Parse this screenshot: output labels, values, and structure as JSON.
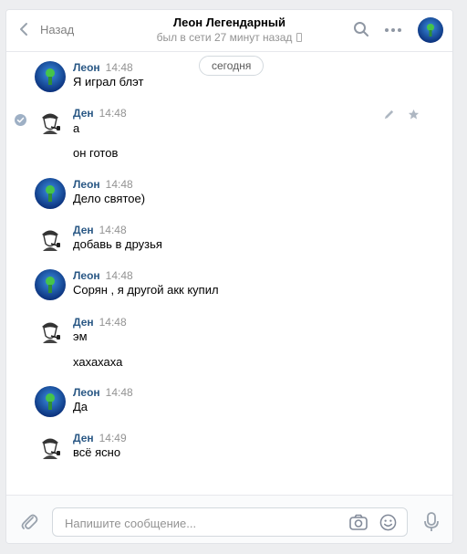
{
  "header": {
    "back_label": "Назад",
    "title": "Леон Легендарный",
    "subtitle": "был в сети 27 минут назад"
  },
  "date_label": "сегодня",
  "messages": [
    {
      "author": "Леон",
      "time": "14:48",
      "avatar": "green-planet-avatar",
      "lines": [
        "Я играл блэт"
      ]
    },
    {
      "author": "Ден",
      "time": "14:48",
      "avatar": "detective-pipe-avatar",
      "lines": [
        "а",
        "он готов"
      ],
      "selected": true
    },
    {
      "author": "Леон",
      "time": "14:48",
      "avatar": "green-planet-avatar",
      "lines": [
        "Дело святое)"
      ]
    },
    {
      "author": "Ден",
      "time": "14:48",
      "avatar": "detective-pipe-avatar",
      "lines": [
        "добавь в друзья"
      ]
    },
    {
      "author": "Леон",
      "time": "14:48",
      "avatar": "green-planet-avatar",
      "lines": [
        "Сорян , я другой акк купил"
      ]
    },
    {
      "author": "Ден",
      "time": "14:48",
      "avatar": "detective-pipe-avatar",
      "lines": [
        "эм",
        "хахахаха"
      ]
    },
    {
      "author": "Леон",
      "time": "14:48",
      "avatar": "green-planet-avatar",
      "lines": [
        "Да"
      ]
    },
    {
      "author": "Ден",
      "time": "14:49",
      "avatar": "detective-pipe-avatar",
      "lines": [
        "всё ясно"
      ]
    }
  ],
  "composer": {
    "placeholder": "Напишите сообщение..."
  },
  "colors": {
    "name_link": "#2a5885",
    "muted": "#939393",
    "background": "#edeef0"
  }
}
